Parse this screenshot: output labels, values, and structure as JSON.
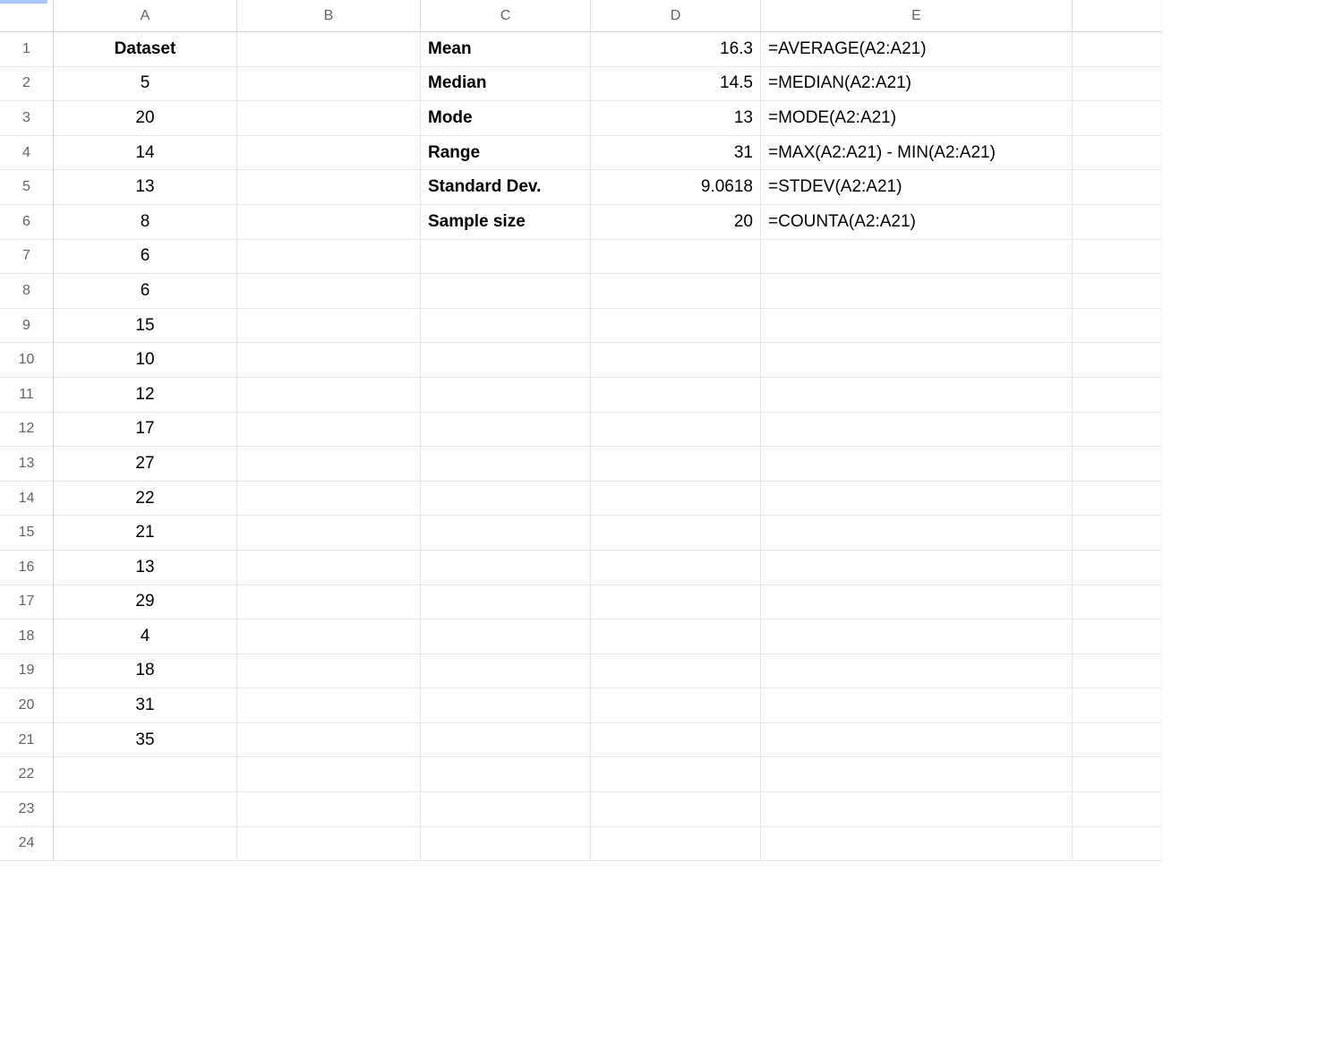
{
  "columns": [
    "A",
    "B",
    "C",
    "D",
    "E"
  ],
  "row_numbers": 24,
  "rows": [
    {
      "A": "Dataset",
      "C": "Mean",
      "D": "16.3",
      "E": "=AVERAGE(A2:A21)",
      "boldA": true,
      "boldC": true
    },
    {
      "A": "5",
      "C": "Median",
      "D": "14.5",
      "E": "=MEDIAN(A2:A21)",
      "boldC": true
    },
    {
      "A": "20",
      "C": "Mode",
      "D": "13",
      "E": "=MODE(A2:A21)",
      "boldC": true
    },
    {
      "A": "14",
      "C": "Range",
      "D": "31",
      "E": "=MAX(A2:A21) - MIN(A2:A21)",
      "boldC": true
    },
    {
      "A": "13",
      "C": "Standard Dev.",
      "D": "9.0618",
      "E": "=STDEV(A2:A21)",
      "boldC": true
    },
    {
      "A": "8",
      "C": "Sample size",
      "D": "20",
      "E": "=COUNTA(A2:A21)",
      "boldC": true
    },
    {
      "A": "6"
    },
    {
      "A": "6"
    },
    {
      "A": "15"
    },
    {
      "A": "10"
    },
    {
      "A": "12"
    },
    {
      "A": "17"
    },
    {
      "A": "27"
    },
    {
      "A": "22"
    },
    {
      "A": "21"
    },
    {
      "A": "13"
    },
    {
      "A": "29"
    },
    {
      "A": "4"
    },
    {
      "A": "18"
    },
    {
      "A": "31"
    },
    {
      "A": "35"
    },
    {},
    {},
    {}
  ]
}
